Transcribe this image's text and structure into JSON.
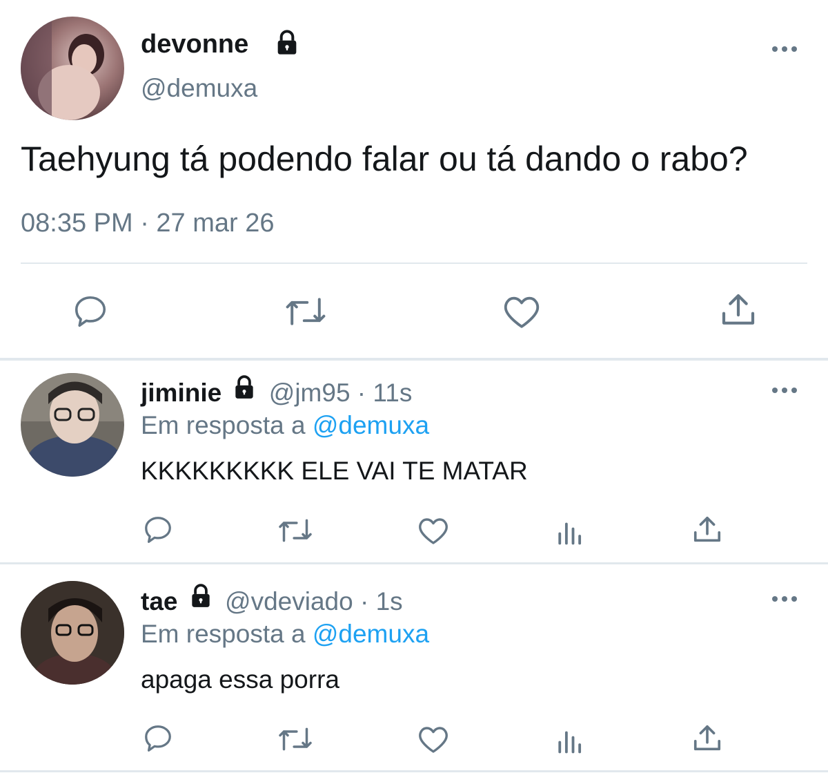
{
  "main_tweet": {
    "display_name": "devonne",
    "handle": "@demuxa",
    "text": "Taehyung tá podendo falar ou tá dando o rabo?",
    "timestamp": "08:35 PM · 27 mar 26",
    "icons": [
      "reply-icon",
      "retweet-icon",
      "like-icon",
      "share-icon"
    ]
  },
  "replies": [
    {
      "display_name": "jiminie",
      "handle_time": "@jm95 · 11s",
      "reply_to_prefix": "Em resposta a",
      "reply_to_handle": "@demuxa",
      "text": "KKKKKKKKK ELE VAI TE MATAR",
      "icons": [
        "reply-icon",
        "retweet-icon",
        "like-icon",
        "analytics-icon",
        "share-icon"
      ]
    },
    {
      "display_name": "tae",
      "handle_time": "@vdeviado · 1s",
      "reply_to_prefix": "Em resposta a",
      "reply_to_handle": "@demuxa",
      "text": "apaga essa porra",
      "icons": [
        "reply-icon",
        "retweet-icon",
        "like-icon",
        "analytics-icon",
        "share-icon"
      ]
    }
  ],
  "colors": {
    "text": "#14171a",
    "muted": "#657786",
    "link": "#1da1f2",
    "divider": "#e1e8ed"
  }
}
